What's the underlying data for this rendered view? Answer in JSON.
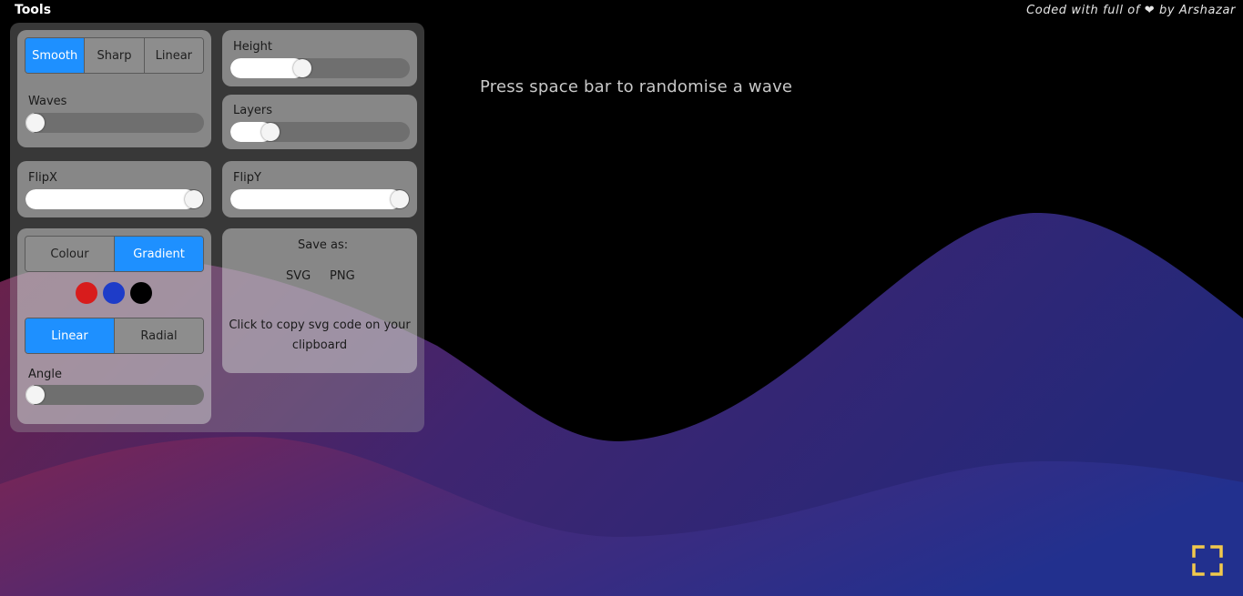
{
  "header": {
    "title": "Tools",
    "credit": "Coded with full of ❤ by Arshazar"
  },
  "hint": "Press space bar to randomise a wave",
  "curve": {
    "options": [
      "Smooth",
      "Sharp",
      "Linear"
    ],
    "selected": "Smooth"
  },
  "sliders": {
    "waves": {
      "label": "Waves",
      "value": 0
    },
    "height": {
      "label": "Height",
      "value": 0.39
    },
    "layers": {
      "label": "Layers",
      "value": 0.19
    },
    "flipx": {
      "label": "FlipX",
      "value": 1
    },
    "flipy": {
      "label": "FlipY",
      "value": 1
    },
    "angle": {
      "label": "Angle",
      "value": 0
    }
  },
  "fill_mode": {
    "options": [
      "Colour",
      "Gradient"
    ],
    "selected": "Gradient"
  },
  "swatches": [
    "#d81c1c",
    "#1e3cc8",
    "#000000"
  ],
  "gradient_type": {
    "options": [
      "Linear",
      "Radial"
    ],
    "selected": "Linear"
  },
  "save": {
    "title": "Save as:",
    "svg": "SVG",
    "png": "PNG",
    "copy": "Click to copy svg code on your clipboard"
  },
  "colors": {
    "accent": "#1e90ff",
    "fullscreen": "#f2c94c",
    "wave_gradient": [
      "#7a2550",
      "#3f2575",
      "#222c8c"
    ]
  },
  "icons": {
    "fullscreen": "fullscreen-icon"
  }
}
